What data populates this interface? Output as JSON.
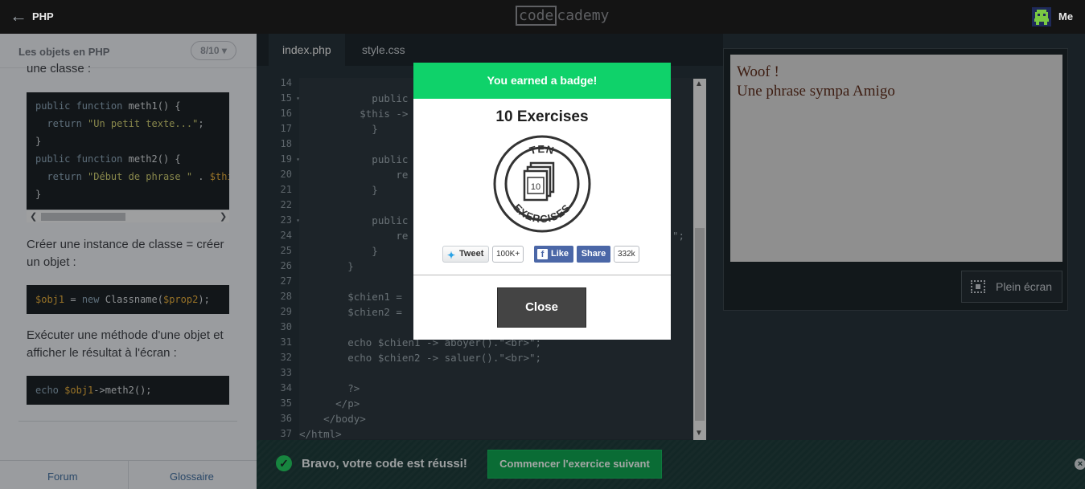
{
  "topbar": {
    "course": "PHP",
    "logo_left": "code",
    "logo_right": "cademy",
    "user": "Me"
  },
  "lesson": {
    "title": "Les objets en PHP",
    "progress": "8/10",
    "text1": "une classe :",
    "text2": "Créer une instance de classe = créer un objet :",
    "text3": "Exécuter une méthode d'une objet et afficher le résultat à l'écran :",
    "code1": [
      "public function meth1() {",
      "  return \"Un petit texte...\";",
      "}",
      "public function meth2() {",
      "  return \"Début de phrase \" . $this",
      "}"
    ],
    "code2": "$obj1 = new Classname($prop2);",
    "code3": "echo $obj1->meth2();"
  },
  "footer": {
    "forum": "Forum",
    "glossary": "Glossaire"
  },
  "editor": {
    "tabs": [
      "index.php",
      "style.css"
    ],
    "line_numbers": [
      "14",
      "15",
      "16",
      "17",
      "18",
      "19",
      "20",
      "21",
      "22",
      "23",
      "24",
      "25",
      "26",
      "27",
      "28",
      "29",
      "30",
      "31",
      "32",
      "33",
      "34",
      "35",
      "36",
      "37"
    ],
    "fold_lines": [
      "15",
      "19",
      "23"
    ],
    "lines": [
      "            public",
      "          $this ->",
      "            }",
      "",
      "            public",
      "                re",
      "            }",
      "",
      "            public",
      "                re",
      "            }",
      "        }",
      "",
      "        $chien1 =",
      "        $chien2 =",
      "",
      "        echo $chien1 -> aboyer().\"<br>\";",
      "        echo $chien2 -> saluer().\"<br>\";",
      "",
      "        ?>",
      "      </p>",
      "    </body>",
      "</html>"
    ],
    "line24_tail": "\";"
  },
  "preview": {
    "line1": "Woof !",
    "line2": "Une phrase sympa Amigo",
    "fullscreen": "Plein écran"
  },
  "bottom": {
    "message": "Bravo, votre code est réussi!",
    "next": "Commencer l'exercice suivant",
    "dismiss": "×"
  },
  "modal": {
    "header": "You earned a badge!",
    "badge_name": "10 Exercises",
    "badge_top_text": "TEN",
    "badge_bottom_text": "EXERCISES",
    "badge_number": "10",
    "tweet": "Tweet",
    "tweet_count": "100K+",
    "like": "Like",
    "share": "Share",
    "share_count": "332k",
    "close": "Close"
  },
  "colors": {
    "accent_green": "#0fd26a",
    "next_button": "#0f9f4e",
    "tag_red": "#c4516a"
  },
  "icons": [
    "back-arrow-icon",
    "avatar-icon",
    "check-icon",
    "twitter-icon",
    "facebook-icon",
    "fullscreen-icon",
    "close-x-icon"
  ]
}
